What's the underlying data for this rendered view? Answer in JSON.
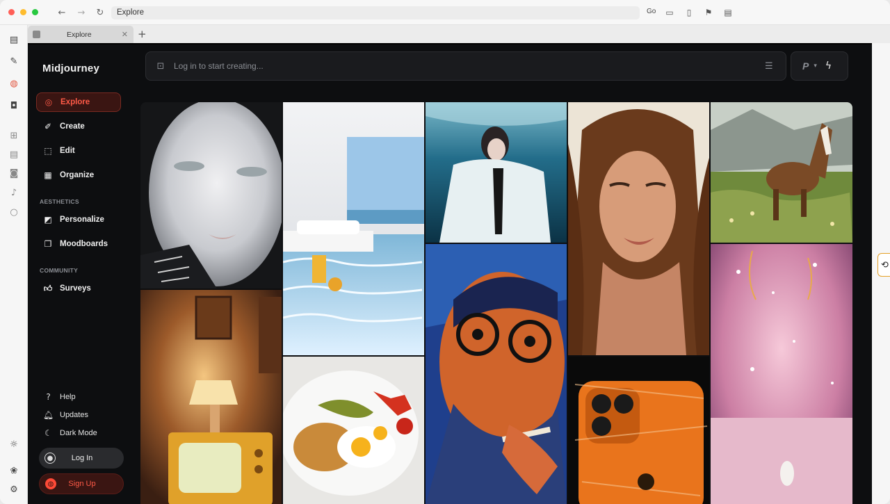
{
  "browser": {
    "url": "Explore",
    "go_label": "Go",
    "tab_title": "Explore",
    "traffic_colors": [
      "#ff5f57",
      "#febc2e",
      "#28c840"
    ]
  },
  "app": {
    "brand": "Midjourney",
    "accent": "#ff5a47",
    "nav": [
      {
        "label": "Explore",
        "icon": "compass-icon",
        "active": true
      },
      {
        "label": "Create",
        "icon": "brush-icon"
      },
      {
        "label": "Edit",
        "icon": "edit-icon"
      },
      {
        "label": "Organize",
        "icon": "grid-icon"
      }
    ],
    "aesthetics": {
      "heading": "AESTHETICS",
      "items": [
        {
          "label": "Personalize",
          "icon": "personalize-icon"
        },
        {
          "label": "Moodboards",
          "icon": "moodboards-icon"
        }
      ]
    },
    "community": {
      "heading": "COMMUNITY",
      "items": [
        {
          "label": "Surveys",
          "icon": "thumbs-up-icon"
        }
      ]
    },
    "footer": {
      "help": "Help",
      "updates": "Updates",
      "dark_mode": "Dark Mode",
      "login": "Log In",
      "signup": "Sign Up"
    },
    "prompt": {
      "placeholder": "Log in to start creating..."
    },
    "mode": {
      "letter": "P"
    }
  },
  "gallery": {
    "tiles": [
      {
        "name": "silver-face"
      },
      {
        "name": "white-pool-room"
      },
      {
        "name": "underwater-girl"
      },
      {
        "name": "brunette-portrait"
      },
      {
        "name": "horse-meadow"
      },
      {
        "name": "retro-tv-room"
      },
      {
        "name": "breakfast-plate"
      },
      {
        "name": "man-glasses-illustration"
      },
      {
        "name": "orange-phone"
      },
      {
        "name": "pink-forest"
      }
    ]
  }
}
